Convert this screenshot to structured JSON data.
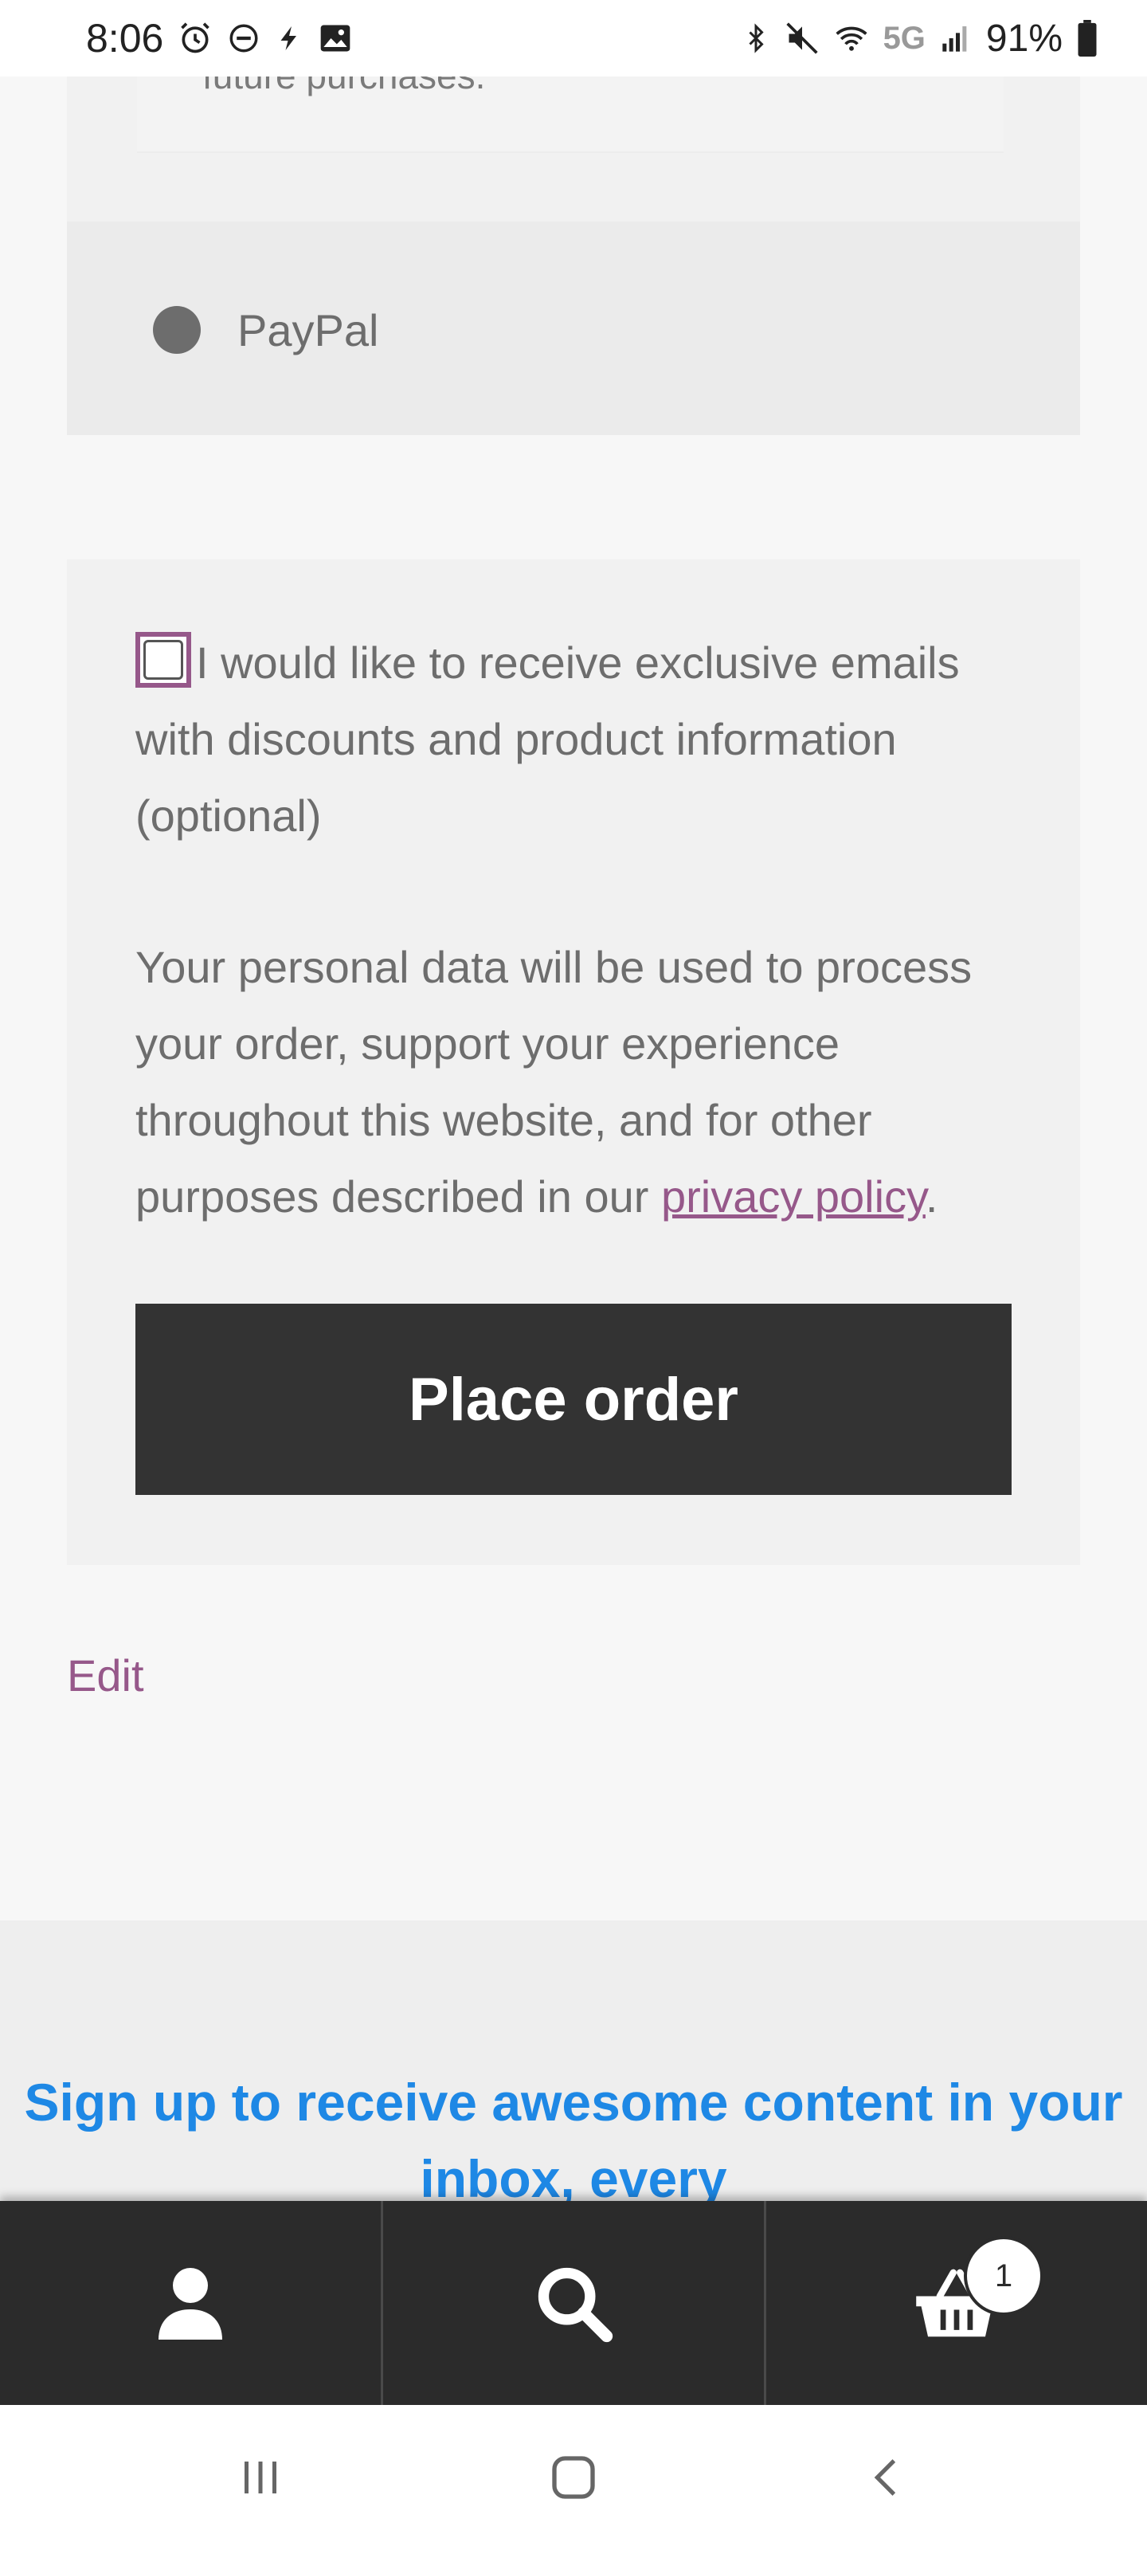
{
  "status_bar": {
    "time": "8:06",
    "battery": "91%",
    "network": "5G",
    "icons": [
      "alarm-icon",
      "dnd-icon",
      "flash-icon",
      "image-icon",
      "bluetooth-icon",
      "mute-icon",
      "wifi-icon",
      "signal-icon",
      "battery-icon"
    ]
  },
  "payment": {
    "prev_description_tail": "future purchases.",
    "paypal_label": "PayPal"
  },
  "terms": {
    "newsletter_label": "I would like to receive exclusive emails with discounts and product information (optional)",
    "privacy_text_before": "Your personal data will be used to process your order, support your experience throughout this website, and for other purposes described in our ",
    "privacy_link": "privacy policy",
    "privacy_text_after": ".",
    "place_order_label": "Place order"
  },
  "edit_label": "Edit",
  "footer": {
    "heading": "Sign up to receive awesome content in your inbox, every"
  },
  "bottom_nav": {
    "items": [
      "account-icon",
      "search-icon",
      "cart-icon"
    ],
    "cart_count": "1"
  },
  "colors": {
    "accent": "#96588a",
    "button_bg": "#333333",
    "heading_blue": "#1e88e5",
    "nav_bg": "#2b2b2b"
  }
}
